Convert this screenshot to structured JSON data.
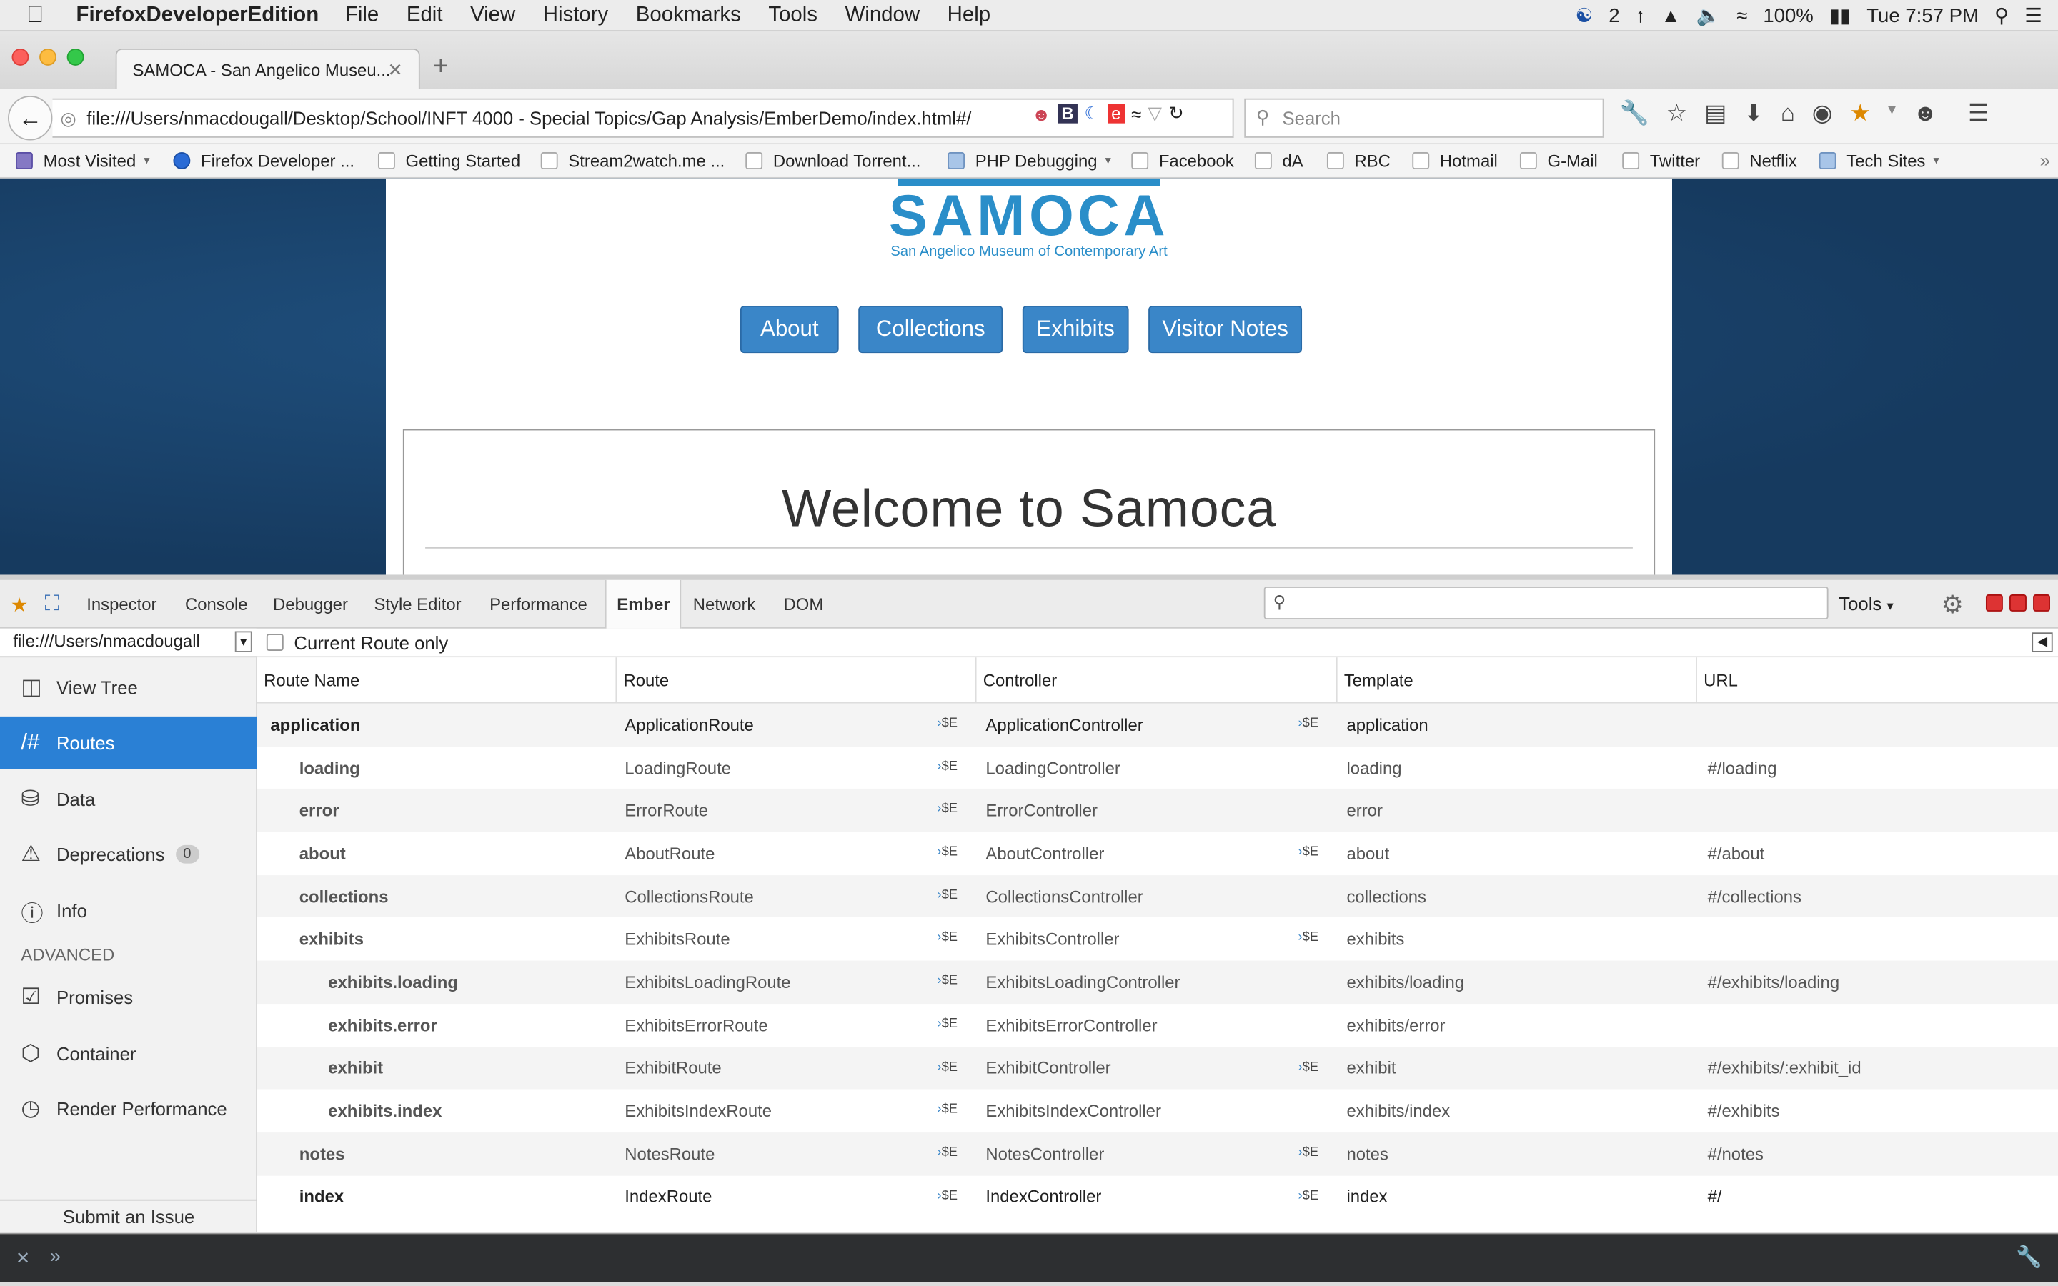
{
  "menubar": {
    "app_name": "FirefoxDeveloperEdition",
    "items": [
      "File",
      "Edit",
      "View",
      "History",
      "Bookmarks",
      "Tools",
      "Window",
      "Help"
    ],
    "cc_badge": "2",
    "battery": "100%",
    "clock": "Tue 7:57 PM"
  },
  "tab": {
    "title": "SAMOCA - San Angelico Museu..."
  },
  "navbar": {
    "url": "file:///Users/nmacdougall/Desktop/School/INFT 4000 - Special Topics/Gap Analysis/EmberDemo/index.html#/",
    "search_placeholder": "Search"
  },
  "bookmarks": [
    {
      "label": "Most Visited",
      "icon": "most-visited",
      "dropdown": true
    },
    {
      "label": "Firefox Developer ...",
      "icon": "firefox"
    },
    {
      "label": "Getting Started",
      "icon": "page"
    },
    {
      "label": "Stream2watch.me ...",
      "icon": "page"
    },
    {
      "label": "Download Torrent...",
      "icon": "page"
    },
    {
      "label": "PHP Debugging",
      "icon": "folder",
      "dropdown": true
    },
    {
      "label": "Facebook",
      "icon": "page"
    },
    {
      "label": "dA",
      "icon": "page"
    },
    {
      "label": "RBC",
      "icon": "page"
    },
    {
      "label": "Hotmail",
      "icon": "page"
    },
    {
      "label": "G-Mail",
      "icon": "page"
    },
    {
      "label": "Twitter",
      "icon": "page"
    },
    {
      "label": "Netflix",
      "icon": "page"
    },
    {
      "label": "Tech Sites",
      "icon": "folder",
      "dropdown": true
    }
  ],
  "page": {
    "logo_text": "SAMOCA",
    "logo_sub": "San Angelico Museum of Contemporary Art",
    "nav_buttons": [
      "About",
      "Collections",
      "Exhibits",
      "Visitor Notes"
    ],
    "welcome": "Welcome to Samoca"
  },
  "devtools": {
    "tabs": [
      "Inspector",
      "Console",
      "Debugger",
      "Style Editor",
      "Performance",
      "Ember",
      "Network",
      "DOM"
    ],
    "active_tab": "Ember",
    "tools_label": "Tools"
  },
  "ember": {
    "app_select": "file:///Users/nmacdougall",
    "current_route_only": "Current Route only",
    "nav": [
      {
        "label": "View Tree",
        "icon": "view-tree"
      },
      {
        "label": "Routes",
        "icon": "routes",
        "active": true
      },
      {
        "label": "Data",
        "icon": "data"
      },
      {
        "label": "Deprecations",
        "icon": "deprecations",
        "badge": "0"
      },
      {
        "label": "Info",
        "icon": "info"
      }
    ],
    "advanced_label": "ADVANCED",
    "advanced_nav": [
      {
        "label": "Promises",
        "icon": "promises"
      },
      {
        "label": "Container",
        "icon": "container"
      },
      {
        "label": "Render Performance",
        "icon": "render-performance"
      }
    ],
    "submit_issue": "Submit an Issue",
    "columns": [
      "Route Name",
      "Route",
      "Controller",
      "Template",
      "URL"
    ],
    "se_label": "$E",
    "routes": [
      {
        "name": "application",
        "route": "ApplicationRoute",
        "controller": "ApplicationController",
        "controller_se": true,
        "template": "application",
        "url": "",
        "depth": 0,
        "strong": true
      },
      {
        "name": "loading",
        "route": "LoadingRoute",
        "controller": "LoadingController",
        "controller_se": false,
        "template": "loading",
        "url": "#/loading",
        "depth": 1
      },
      {
        "name": "error",
        "route": "ErrorRoute",
        "controller": "ErrorController",
        "controller_se": false,
        "template": "error",
        "url": "",
        "depth": 1
      },
      {
        "name": "about",
        "route": "AboutRoute",
        "controller": "AboutController",
        "controller_se": true,
        "template": "about",
        "url": "#/about",
        "depth": 1
      },
      {
        "name": "collections",
        "route": "CollectionsRoute",
        "controller": "CollectionsController",
        "controller_se": false,
        "template": "collections",
        "url": "#/collections",
        "depth": 1
      },
      {
        "name": "exhibits",
        "route": "ExhibitsRoute",
        "controller": "ExhibitsController",
        "controller_se": true,
        "template": "exhibits",
        "url": "",
        "depth": 1
      },
      {
        "name": "exhibits.loading",
        "route": "ExhibitsLoadingRoute",
        "controller": "ExhibitsLoadingController",
        "controller_se": false,
        "template": "exhibits/loading",
        "url": "#/exhibits/loading",
        "depth": 2
      },
      {
        "name": "exhibits.error",
        "route": "ExhibitsErrorRoute",
        "controller": "ExhibitsErrorController",
        "controller_se": false,
        "template": "exhibits/error",
        "url": "",
        "depth": 2
      },
      {
        "name": "exhibit",
        "route": "ExhibitRoute",
        "controller": "ExhibitController",
        "controller_se": true,
        "template": "exhibit",
        "url": "#/exhibits/:exhibit_id",
        "depth": 2
      },
      {
        "name": "exhibits.index",
        "route": "ExhibitsIndexRoute",
        "controller": "ExhibitsIndexController",
        "controller_se": false,
        "template": "exhibits/index",
        "url": "#/exhibits",
        "depth": 2
      },
      {
        "name": "notes",
        "route": "NotesRoute",
        "controller": "NotesController",
        "controller_se": true,
        "template": "notes",
        "url": "#/notes",
        "depth": 1
      },
      {
        "name": "index",
        "route": "IndexRoute",
        "controller": "IndexController",
        "controller_se": true,
        "template": "index",
        "url": "#/",
        "depth": 1,
        "strong": true
      }
    ]
  }
}
